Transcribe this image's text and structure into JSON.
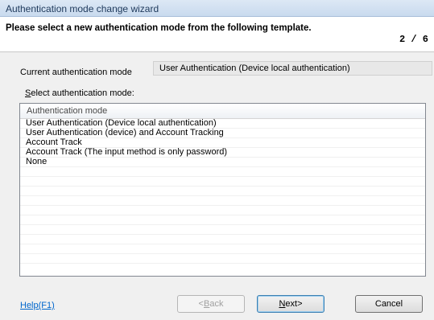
{
  "window": {
    "title": "Authentication mode change wizard"
  },
  "header": {
    "instruction": "Please select a new authentication mode from the following template.",
    "step": "2 / 6"
  },
  "current_mode": {
    "label": "Current authentication mode",
    "value": "User Authentication (Device local authentication)"
  },
  "select_mode": {
    "label_prefix": "S",
    "label_rest": "elect authentication mode:",
    "column_header": "Authentication mode",
    "options": [
      "User Authentication (Device local authentication)",
      "User Authentication (device) and Account Tracking",
      "Account Track",
      "Account Track (The input method is only password)",
      "None"
    ]
  },
  "footer": {
    "help_link": "Help(F1)",
    "back_pre": "<",
    "back_u": "B",
    "back_post": "ack",
    "next_u": "N",
    "next_post": "ext>",
    "cancel": "Cancel"
  }
}
